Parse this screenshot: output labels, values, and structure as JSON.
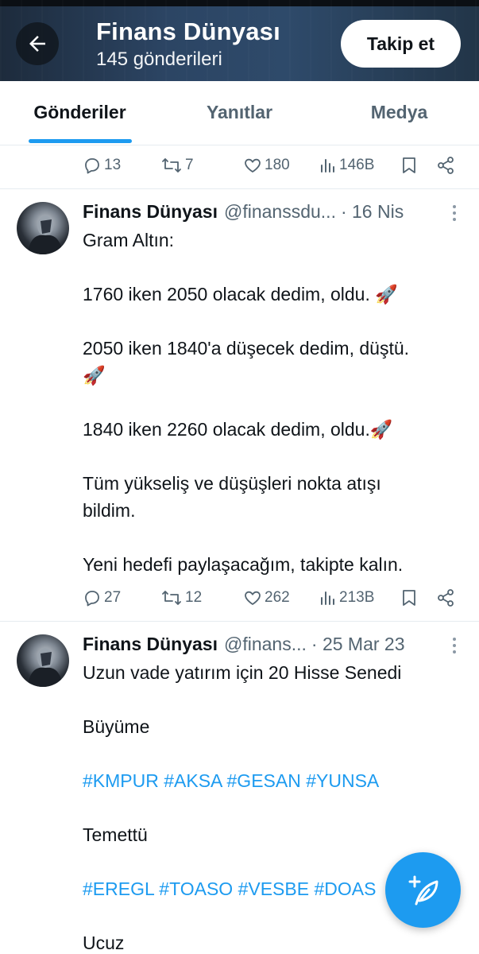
{
  "header": {
    "title": "Finans Dünyası",
    "subtitle": "145 gönderileri",
    "follow_label": "Takip et",
    "back_icon": "arrow-left-icon"
  },
  "tabs": [
    {
      "label": "Gönderiler",
      "active": true
    },
    {
      "label": "Yanıtlar",
      "active": false
    },
    {
      "label": "Medya",
      "active": false
    }
  ],
  "previous_tweet_actions": {
    "replies": "13",
    "retweets": "7",
    "likes": "180",
    "views": "146B"
  },
  "tweets": [
    {
      "name": "Finans Dünyası",
      "handle": "@finanssdu...",
      "date": "· 16 Nis",
      "lines": [
        "Gram Altın:",
        "",
        "1760 iken 2050 olacak dedim, oldu. 🚀",
        "",
        "2050 iken 1840'a düşecek dedim, düştü.",
        "🚀",
        "",
        "1840 iken 2260 olacak dedim, oldu.🚀",
        "",
        "Tüm yükseliş ve düşüşleri nokta atışı",
        "bildim.",
        "",
        "Yeni hedefi paylaşacağım, takipte kalın."
      ],
      "actions": {
        "replies": "27",
        "retweets": "12",
        "likes": "262",
        "views": "213B"
      }
    },
    {
      "name": "Finans Dünyası",
      "handle": "@finans...",
      "date": "· 25 Mar 23",
      "lines": [
        "Uzun vade yatırım için 20 Hisse Senedi",
        "",
        "Büyüme",
        "",
        "#KMPUR #AKSA #GESAN #YUNSA",
        "",
        "Temettü",
        "",
        "#EREGL #TOASO #VESBE #DOAS",
        "",
        "Ucuz"
      ]
    }
  ],
  "fab": {
    "icon": "compose-feather-icon"
  },
  "colors": {
    "accent": "#1d9bf0",
    "text": "#0f1419",
    "muted": "#536471",
    "divider": "#e6ecf0"
  }
}
